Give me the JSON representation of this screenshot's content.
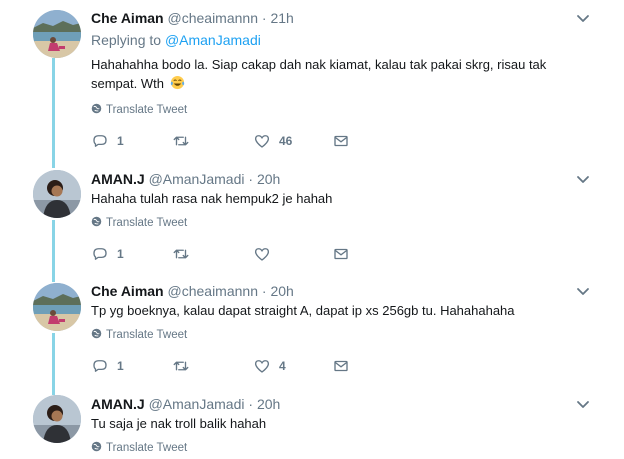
{
  "translate_label": "Translate Tweet",
  "tweets": [
    {
      "name": "Che Aiman",
      "handle": "@cheaimannn",
      "separator": "·",
      "time": "21h",
      "replying_prefix": "Replying to",
      "replying_to": "@AmanJamadi",
      "text": "Hahahahha bodo la. Siap cakap dah nak kiamat, kalau tak pakai skrg, risau tak sempat. Wth",
      "emoji": "face-with-tears-of-joy",
      "replies": "1",
      "retweets": "",
      "likes": "46"
    },
    {
      "name": "AMAN.J",
      "handle": "@AmanJamadi",
      "separator": "·",
      "time": "20h",
      "text": "Hahaha tulah rasa nak hempuk2 je hahah",
      "replies": "1",
      "retweets": "",
      "likes": ""
    },
    {
      "name": "Che Aiman",
      "handle": "@cheaimannn",
      "separator": "·",
      "time": "20h",
      "text": "Tp yg boeknya, kalau dapat straight A, dapat ip xs 256gb tu. Hahahahaha",
      "replies": "1",
      "retweets": "",
      "likes": "4"
    },
    {
      "name": "AMAN.J",
      "handle": "@AmanJamadi",
      "separator": "·",
      "time": "20h",
      "text": "Tu saja je nak troll balik hahah"
    }
  ],
  "colors": {
    "thread_line": "#88d4e6",
    "link": "#1da1f2",
    "muted": "#657786",
    "text": "#14171a"
  }
}
